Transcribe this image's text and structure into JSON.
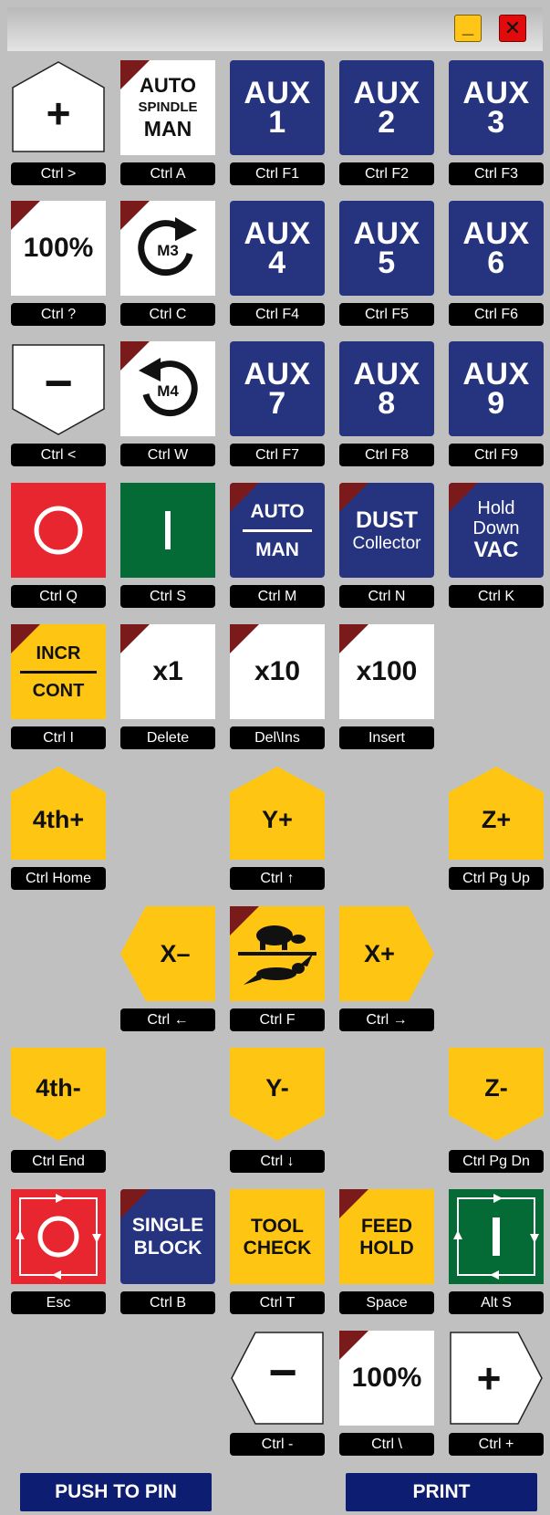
{
  "colors": {
    "navy": "#263480",
    "yellow": "#ffc513",
    "red": "#e82630",
    "green": "#056b36",
    "corner": "#7a1a1a",
    "footer": "#0c1d72"
  },
  "window": {
    "minimize": "_",
    "close": "✕"
  },
  "row1": {
    "jog_plus": "+",
    "auto": "AUTO",
    "spindle": "SPINDLE",
    "man": "MAN",
    "aux1a": "AUX",
    "aux1b": "1",
    "aux2a": "AUX",
    "aux2b": "2",
    "aux3a": "AUX",
    "aux3b": "3",
    "keys": [
      "Ctrl >",
      "Ctrl A",
      "Ctrl F1",
      "Ctrl F2",
      "Ctrl F3"
    ]
  },
  "row2": {
    "feed_pct": "100%",
    "m3": "M3",
    "aux4a": "AUX",
    "aux4b": "4",
    "aux5a": "AUX",
    "aux5b": "5",
    "aux6a": "AUX",
    "aux6b": "6",
    "keys": [
      "Ctrl ?",
      "Ctrl C",
      "Ctrl F4",
      "Ctrl F5",
      "Ctrl F6"
    ]
  },
  "row3": {
    "jog_minus": "−",
    "m4": "M4",
    "aux7a": "AUX",
    "aux7b": "7",
    "aux8a": "AUX",
    "aux8b": "8",
    "aux9a": "AUX",
    "aux9b": "9",
    "keys": [
      "Ctrl <",
      "Ctrl W",
      "Ctrl F7",
      "Ctrl F8",
      "Ctrl F9"
    ]
  },
  "row4": {
    "auto": "AUTO",
    "man": "MAN",
    "dust1": "DUST",
    "dust2": "Collector",
    "hold1": "Hold",
    "hold2": "Down",
    "hold3": "VAC",
    "keys": [
      "Ctrl Q",
      "Ctrl S",
      "Ctrl M",
      "Ctrl N",
      "Ctrl K"
    ]
  },
  "row5": {
    "incr": "INCR",
    "cont": "CONT",
    "x1": "x1",
    "x10": "x10",
    "x100": "x100",
    "keys": [
      "Ctrl I",
      "Delete",
      "Del\\Ins",
      "Insert"
    ]
  },
  "jog": {
    "a_plus": "4th+",
    "y_plus": "Y+",
    "z_plus": "Z+",
    "x_minus": "X–",
    "x_plus": "X+",
    "a_minus": "4th-",
    "y_minus": "Y-",
    "z_minus": "Z-",
    "keys": {
      "a_plus": "Ctrl Home",
      "y_plus": "Ctrl ↑",
      "z_plus": "Ctrl Pg Up",
      "x_minus": "Ctrl ←",
      "rate": "Ctrl F",
      "x_plus": "Ctrl →",
      "a_minus": "Ctrl End",
      "y_minus": "Ctrl ↓",
      "z_minus": "Ctrl Pg Dn"
    }
  },
  "row9": {
    "single1": "SINGLE",
    "single2": "BLOCK",
    "tool1": "TOOL",
    "tool2": "CHECK",
    "feed1": "FEED",
    "feed2": "HOLD",
    "keys": [
      "Esc",
      "Ctrl B",
      "Ctrl T",
      "Space",
      "Alt S"
    ]
  },
  "row10": {
    "minus": "−",
    "pct": "100%",
    "plus": "+",
    "keys": [
      "Ctrl -",
      "Ctrl \\",
      "Ctrl +"
    ]
  },
  "footer": {
    "push_to_pin": "PUSH TO PIN",
    "print": "PRINT"
  }
}
